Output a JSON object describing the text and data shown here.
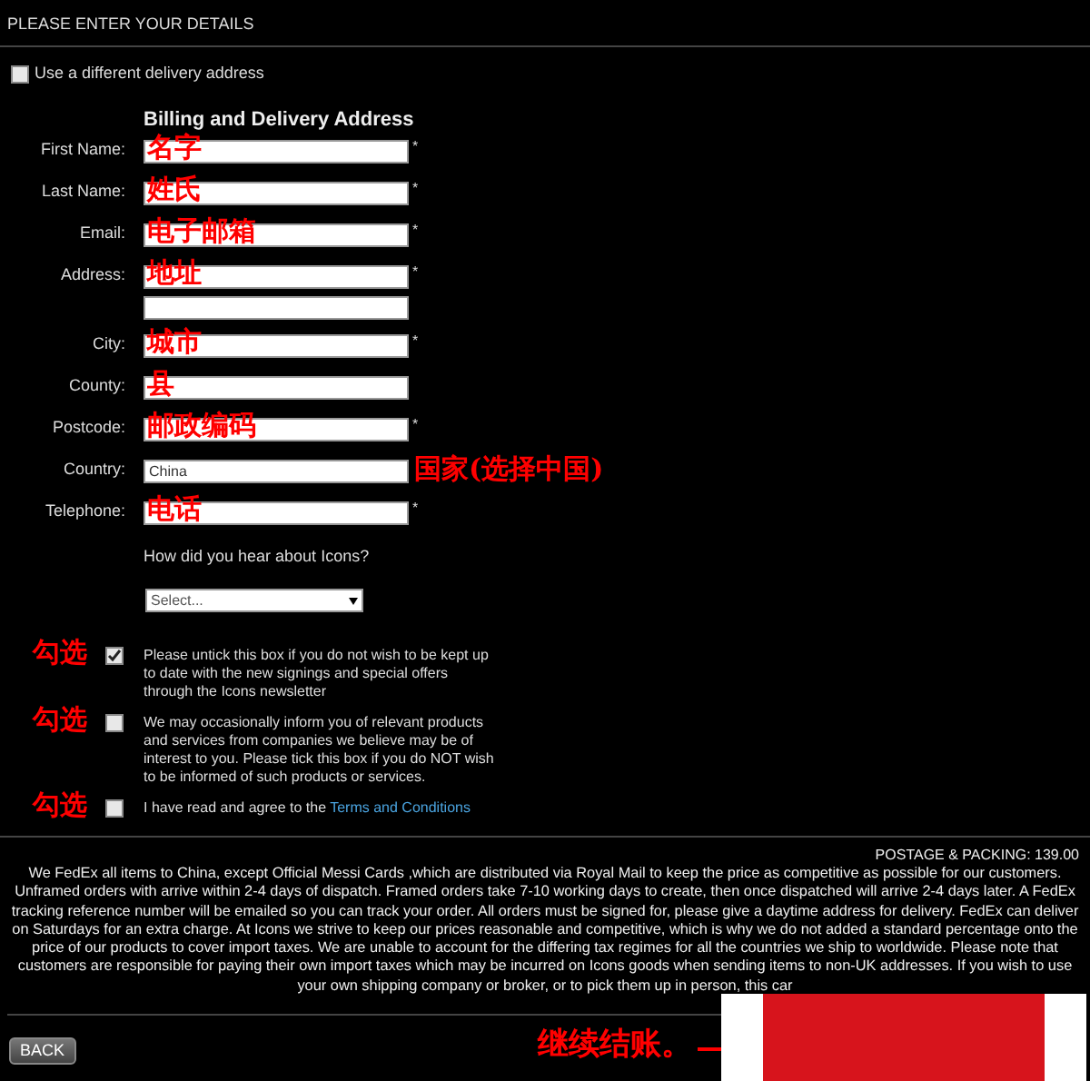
{
  "header": {
    "title": "PLEASE ENTER YOUR DETAILS"
  },
  "delivery_option": {
    "label": "Use a different delivery address",
    "checked": false
  },
  "form": {
    "title": "Billing and Delivery Address",
    "required_marker": "*",
    "fields": [
      {
        "kind": "text",
        "label": "First Name:",
        "required": true,
        "annotation": "名字"
      },
      {
        "kind": "text",
        "label": "Last Name:",
        "required": true,
        "annotation": "姓氏"
      },
      {
        "kind": "text",
        "label": "Email:",
        "required": true,
        "annotation": "电子邮箱"
      },
      {
        "kind": "address",
        "label": "Address:",
        "required": true,
        "annotation": "地址"
      },
      {
        "kind": "text",
        "label": "City:",
        "required": true,
        "annotation": "城市"
      },
      {
        "kind": "text",
        "label": "County:",
        "required": false,
        "annotation": "县"
      },
      {
        "kind": "text",
        "label": "Postcode:",
        "required": true,
        "annotation": "邮政编码"
      },
      {
        "kind": "select",
        "label": "Country:",
        "required": false,
        "value": "China",
        "annotation": "国家(选择中国)"
      },
      {
        "kind": "text",
        "label": "Telephone:",
        "required": true,
        "annotation": "电话"
      }
    ],
    "question": "How did you hear about Icons?",
    "source_select": {
      "placeholder": "Select..."
    }
  },
  "consents": [
    {
      "annotation": "勾选",
      "checked": true,
      "text": "Please untick this box if you do not wish to be kept up to date with the new signings and special offers through the Icons newsletter"
    },
    {
      "annotation": "勾选",
      "checked": false,
      "text": "We may occasionally inform you of relevant products and services from companies we believe may be of interest to you. Please tick this box if you do NOT wish to be informed of such products or services."
    },
    {
      "annotation": "勾选",
      "checked": false,
      "text": "I have read and agree to the ",
      "link": "Terms and Conditions"
    }
  ],
  "footer": {
    "postage": "POSTAGE & PACKING: 139.00",
    "notice": "We FedEx all items to China, except Official Messi Cards ,which are distributed via Royal Mail to keep the price as competitive as possible for our customers. Unframed orders with arrive within 2-4 days of dispatch. Framed orders take 7-10 working days to create, then once dispatched will arrive 2-4 days later. A FedEx tracking reference number will be emailed so you can track your order. All orders must be signed for, please give a daytime address for delivery. FedEx can deliver on Saturdays for an extra charge. At Icons we strive to keep our prices reasonable and competitive, which is why we do not added a standard percentage onto the price of our products to cover import taxes. We are unable to account for the differing tax regimes for all the countries we ship to worldwide. Please note that customers are responsible for paying their own import taxes which may be incurred on Icons goods when sending items to non-UK addresses. If you wish to use your own shipping company or broker, or to pick them up in person, this car",
    "back_button": "BACK",
    "annotation": "继续结账。"
  }
}
